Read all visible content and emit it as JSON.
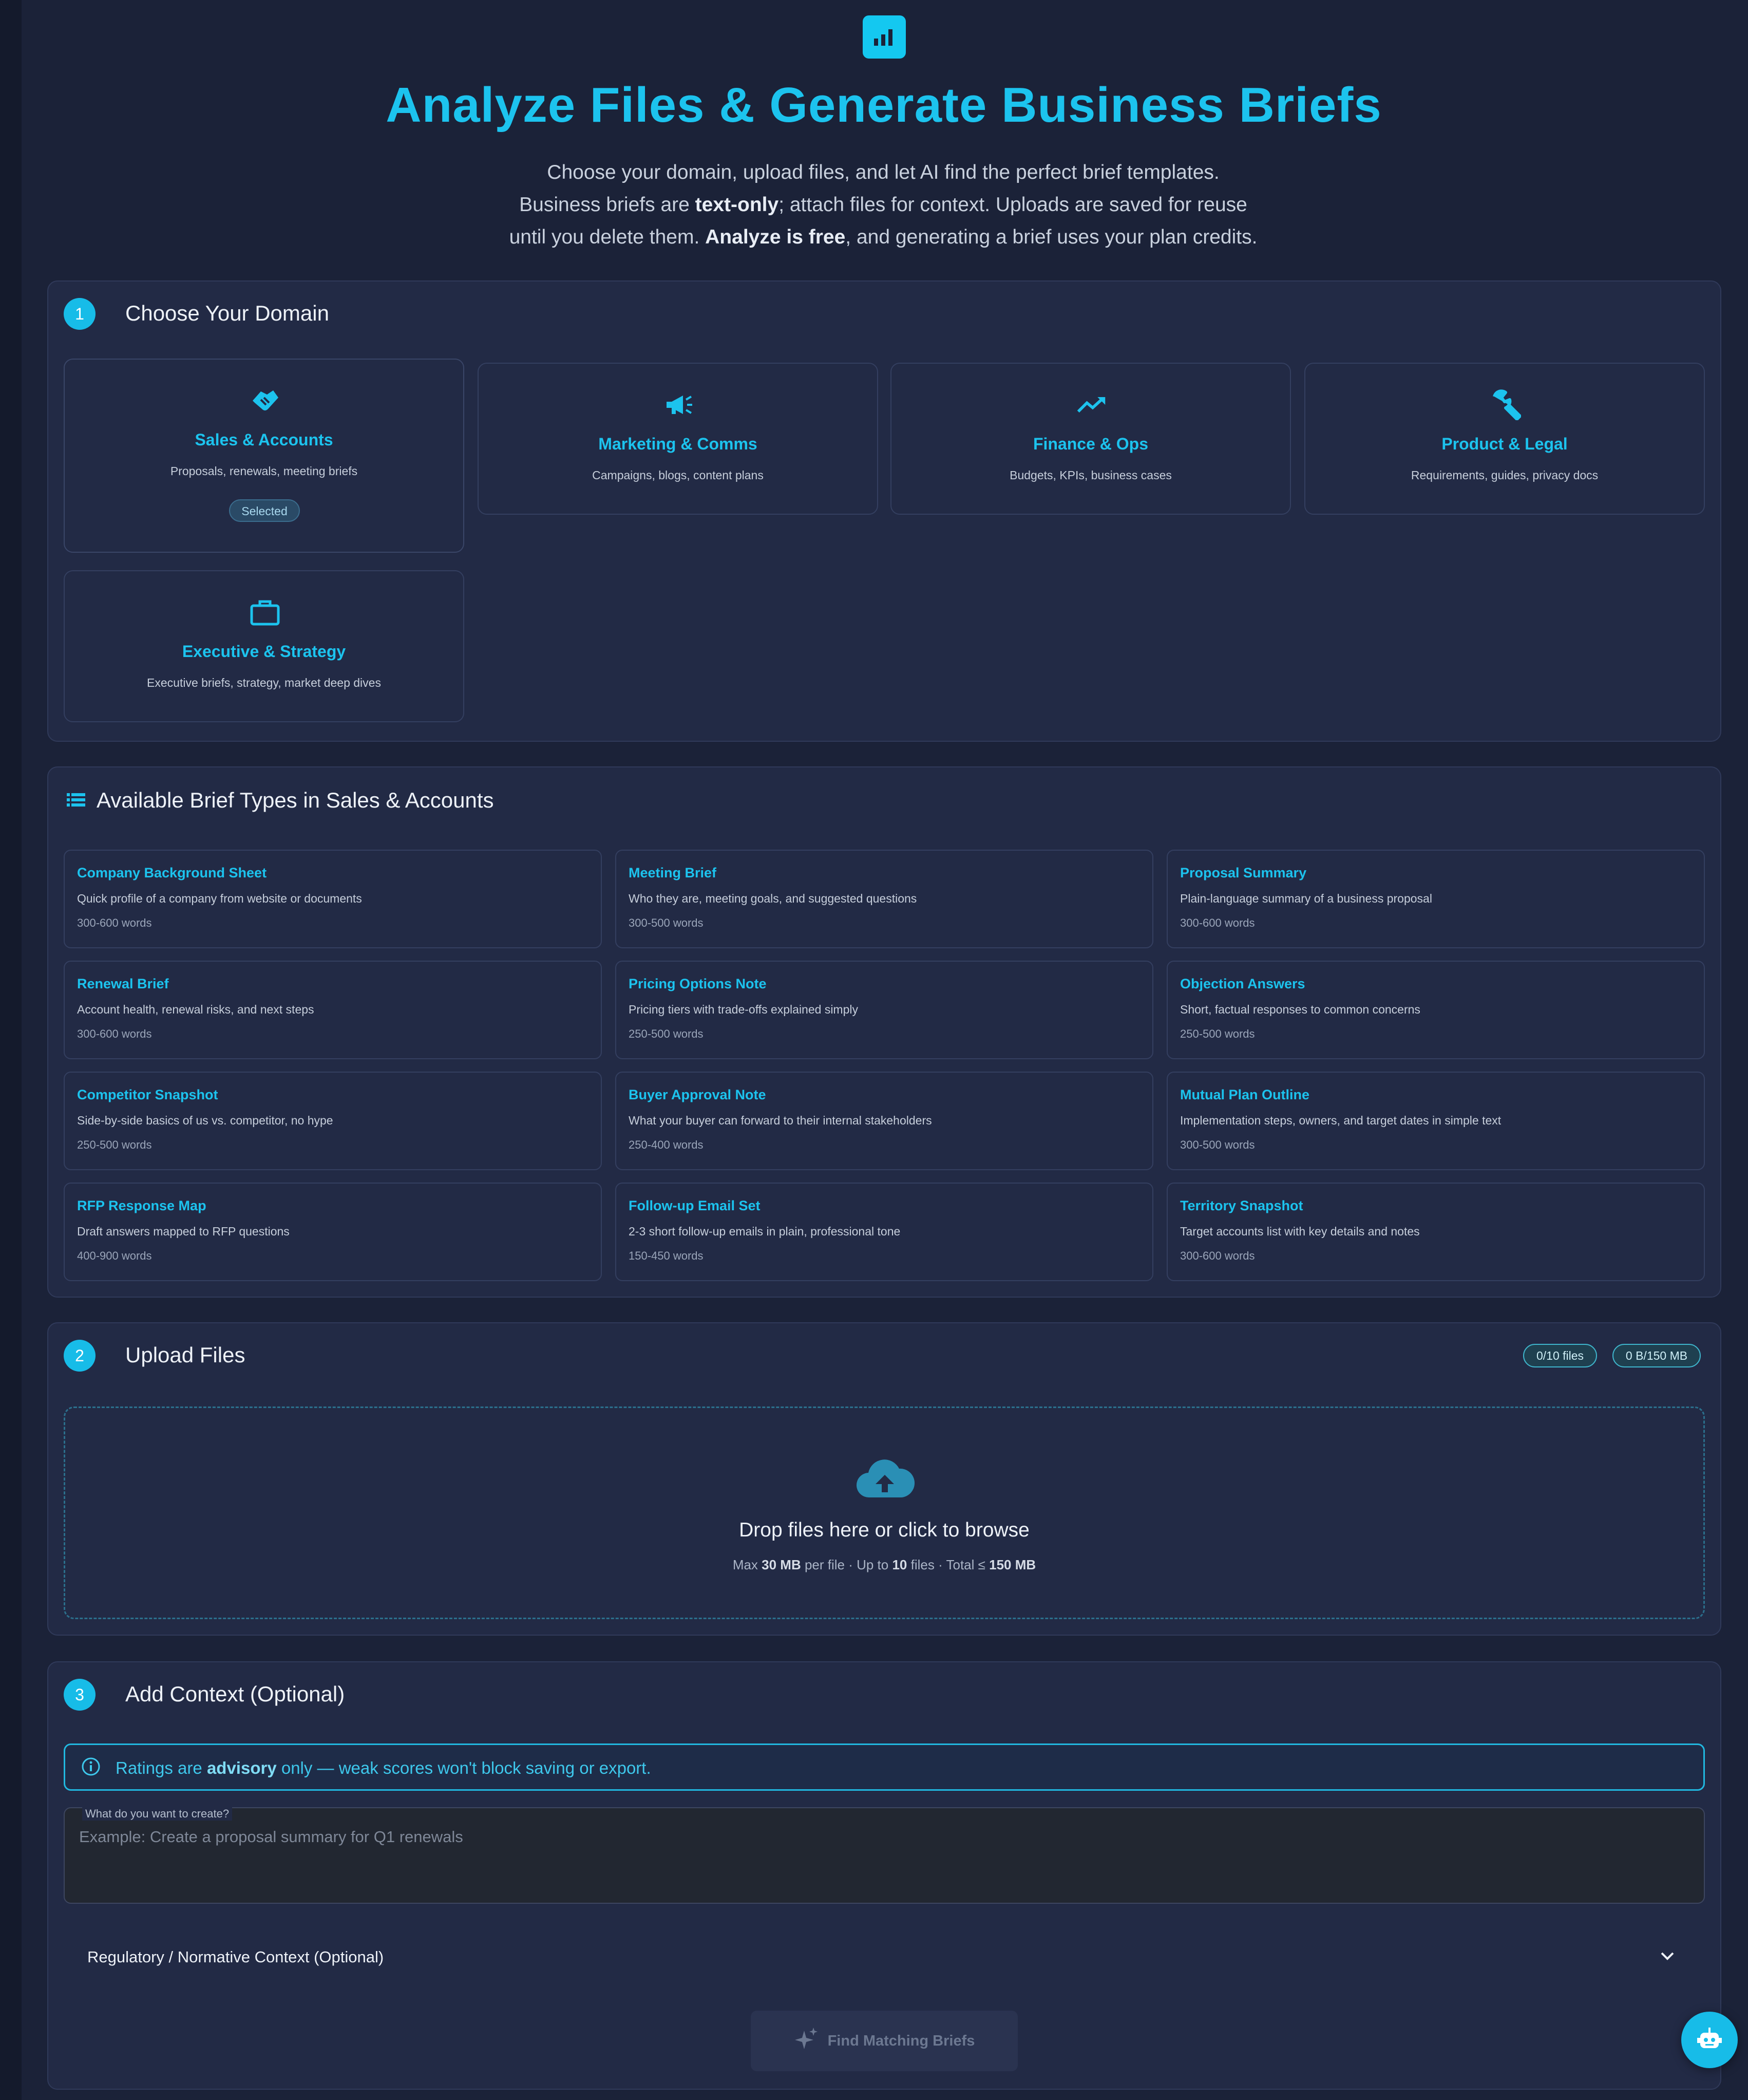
{
  "hero": {
    "icon": "bar-chart-icon",
    "title": "Analyze Files & Generate Business Briefs",
    "line1": "Choose your domain, upload files, and let AI find the perfect brief templates.",
    "line2_pre": "Business briefs are ",
    "line2_bold": "text-only",
    "line2_post": "; attach files for context. Uploads are saved for reuse",
    "line3_pre": "until you delete them. ",
    "line3_bold": "Analyze is free",
    "line3_post": ", and generating a brief uses your plan credits."
  },
  "step1": {
    "number": "1",
    "title": "Choose Your Domain",
    "domains": [
      {
        "icon": "handshake-icon",
        "name": "Sales & Accounts",
        "desc": "Proposals, renewals, meeting briefs",
        "badge": "Selected"
      },
      {
        "icon": "megaphone-icon",
        "name": "Marketing & Comms",
        "desc": "Campaigns, blogs, content plans"
      },
      {
        "icon": "trending-up-icon",
        "name": "Finance & Ops",
        "desc": "Budgets, KPIs, business cases"
      },
      {
        "icon": "wrench-icon",
        "name": "Product & Legal",
        "desc": "Requirements, guides, privacy docs"
      },
      {
        "icon": "briefcase-icon",
        "name": "Executive & Strategy",
        "desc": "Executive briefs, strategy, market deep dives"
      }
    ]
  },
  "briefs": {
    "icon": "list-icon",
    "title": "Available Brief Types in Sales & Accounts",
    "items": [
      {
        "name": "Company Background Sheet",
        "desc": "Quick profile of a company from website or documents",
        "words": "300-600 words"
      },
      {
        "name": "Meeting Brief",
        "desc": "Who they are, meeting goals, and suggested questions",
        "words": "300-500 words"
      },
      {
        "name": "Proposal Summary",
        "desc": "Plain-language summary of a business proposal",
        "words": "300-600 words"
      },
      {
        "name": "Renewal Brief",
        "desc": "Account health, renewal risks, and next steps",
        "words": "300-600 words"
      },
      {
        "name": "Pricing Options Note",
        "desc": "Pricing tiers with trade-offs explained simply",
        "words": "250-500 words"
      },
      {
        "name": "Objection Answers",
        "desc": "Short, factual responses to common concerns",
        "words": "250-500 words"
      },
      {
        "name": "Competitor Snapshot",
        "desc": "Side-by-side basics of us vs. competitor, no hype",
        "words": "250-500 words"
      },
      {
        "name": "Buyer Approval Note",
        "desc": "What your buyer can forward to their internal stakeholders",
        "words": "250-400 words"
      },
      {
        "name": "Mutual Plan Outline",
        "desc": "Implementation steps, owners, and target dates in simple text",
        "words": "300-500 words"
      },
      {
        "name": "RFP Response Map",
        "desc": "Draft answers mapped to RFP questions",
        "words": "400-900 words"
      },
      {
        "name": "Follow-up Email Set",
        "desc": "2-3 short follow-up emails in plain, professional tone",
        "words": "150-450 words"
      },
      {
        "name": "Territory Snapshot",
        "desc": "Target accounts list with key details and notes",
        "words": "300-600 words"
      }
    ]
  },
  "step2": {
    "number": "2",
    "title": "Upload Files",
    "files_count": "0/10 files",
    "size_count": "0 B/150 MB",
    "drop_icon": "cloud-upload-icon",
    "drop_title": "Drop files here or click to browse",
    "meta_1": "Max ",
    "meta_2": "30 MB",
    "meta_3": " per file · Up to ",
    "meta_4": "10",
    "meta_5": " files · Total ≤ ",
    "meta_6": "150 MB"
  },
  "step3": {
    "number": "3",
    "title": "Add Context (Optional)",
    "info_icon": "info-icon",
    "info_pre": "Ratings are ",
    "info_bold": "advisory",
    "info_post": " only — weak scores won't block saving or export.",
    "field_label": "What do you want to create?",
    "field_placeholder": "Example: Create a proposal summary for Q1 renewals",
    "field_value": "",
    "accordion_label": "Regulatory / Normative Context (Optional)",
    "find_button": "Find Matching Briefs"
  },
  "fab_icon": "robot-icon",
  "colors": {
    "accent": "#1cc3ee",
    "background": "#1b2238",
    "card": "#222a45"
  }
}
